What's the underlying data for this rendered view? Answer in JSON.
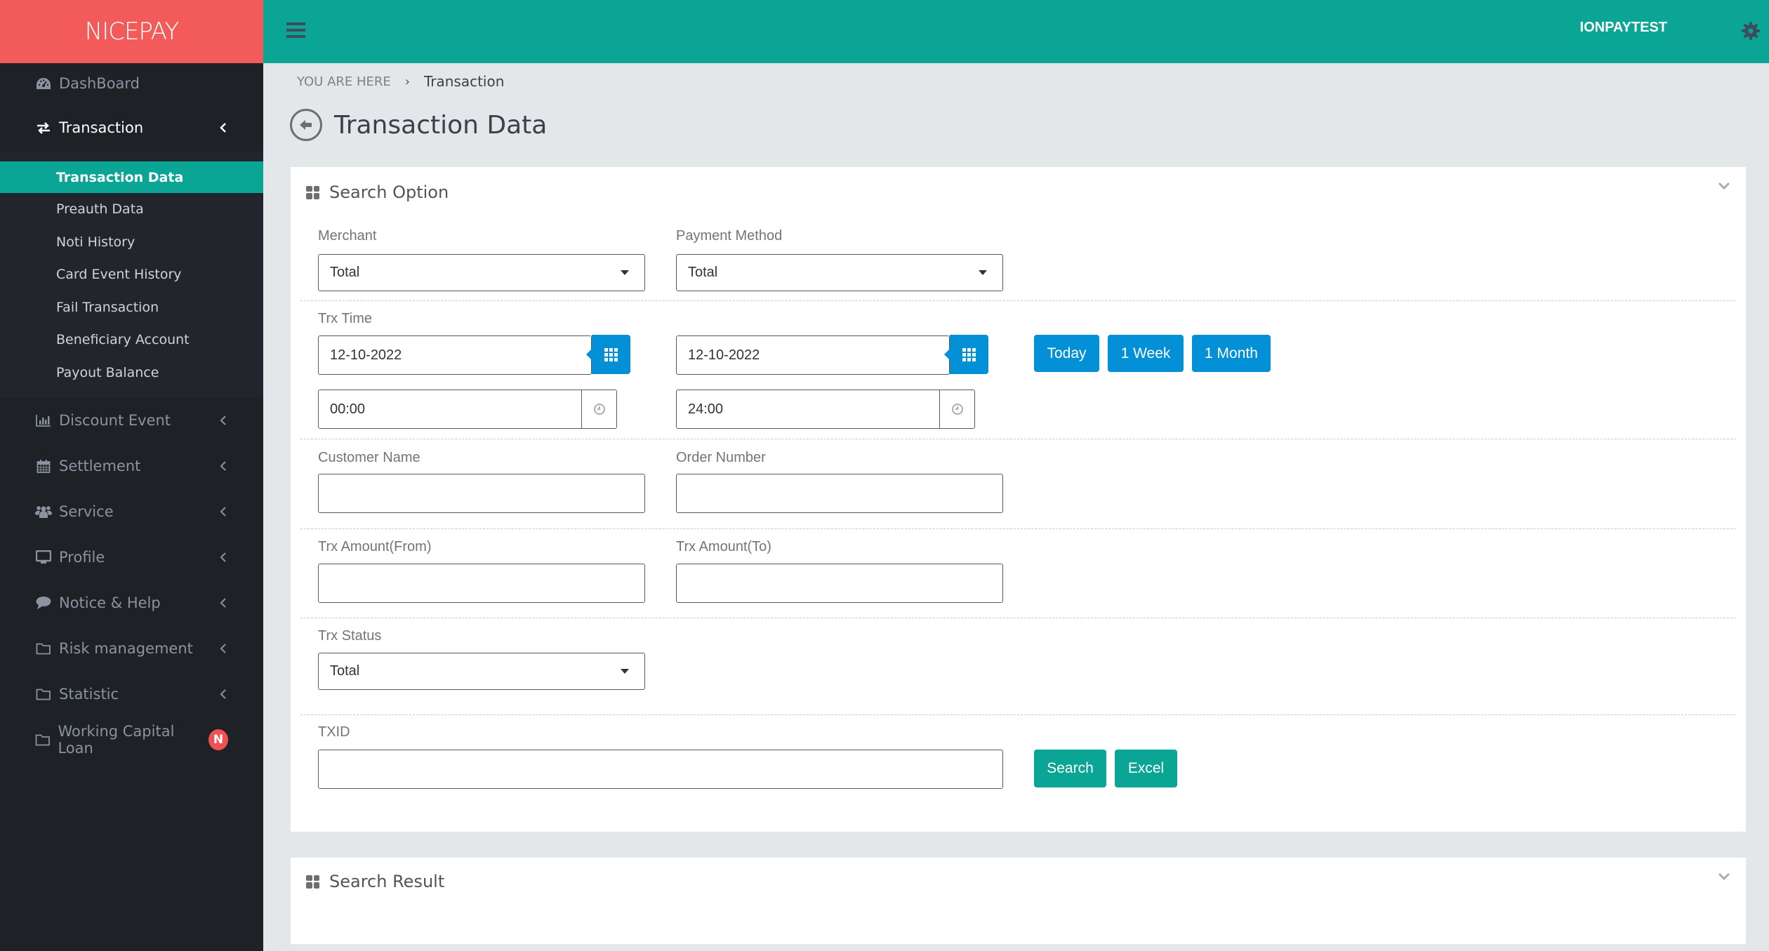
{
  "app": {
    "brand": "NICEPAY",
    "user": "IONPAYTEST"
  },
  "sidebar": {
    "items": [
      {
        "label": "DashBoard",
        "icon": "dashboard-icon"
      },
      {
        "label": "Transaction",
        "icon": "exchange-icon",
        "expanded": true
      },
      {
        "label": "Discount Event",
        "icon": "bar-chart-icon"
      },
      {
        "label": "Settlement",
        "icon": "calendar-icon"
      },
      {
        "label": "Service",
        "icon": "users-icon"
      },
      {
        "label": "Profile",
        "icon": "monitor-icon"
      },
      {
        "label": "Notice & Help",
        "icon": "comment-icon"
      },
      {
        "label": "Risk management",
        "icon": "folder-icon"
      },
      {
        "label": "Statistic",
        "icon": "folder-icon"
      },
      {
        "label": "Working Capital Loan",
        "icon": "folder-icon",
        "badge": "N"
      }
    ],
    "transaction_submenu": [
      "Transaction Data",
      "Preauth Data",
      "Noti History",
      "Card Event History",
      "Fail Transaction",
      "Beneficiary Account",
      "Payout Balance"
    ]
  },
  "breadcrumb": {
    "prefix": "YOU ARE HERE",
    "separator": "›",
    "current": "Transaction"
  },
  "page": {
    "title": "Transaction Data"
  },
  "search_option": {
    "title": "Search Option",
    "merchant": {
      "label": "Merchant",
      "value": "Total"
    },
    "payment_method": {
      "label": "Payment Method",
      "value": "Total"
    },
    "trx_time": {
      "label": "Trx Time",
      "start_date": "12-10-2022",
      "end_date": "12-10-2022",
      "start_time": "00:00",
      "end_time": "24:00"
    },
    "quick_ranges": [
      "Today",
      "1 Week",
      "1 Month"
    ],
    "customer_name": {
      "label": "Customer Name",
      "value": ""
    },
    "order_number": {
      "label": "Order Number",
      "value": ""
    },
    "amount_from": {
      "label": "Trx Amount(From)",
      "value": ""
    },
    "amount_to": {
      "label": "Trx Amount(To)",
      "value": ""
    },
    "trx_status": {
      "label": "Trx Status",
      "value": "Total"
    },
    "txid": {
      "label": "TXID",
      "value": ""
    },
    "search_button": "Search",
    "excel_button": "Excel"
  },
  "search_result": {
    "title": "Search Result"
  },
  "colors": {
    "brand": "#f35b5b",
    "header": "#0ba595",
    "primary_blue": "#0390d7",
    "sidebar_bg": "#1e2125"
  }
}
